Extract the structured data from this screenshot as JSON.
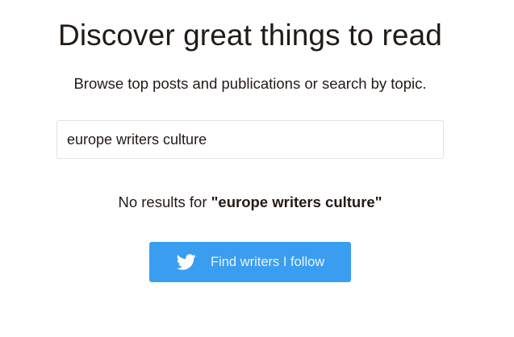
{
  "header": {
    "title": "Discover great things to read",
    "subtitle": "Browse top posts and publications or search by topic."
  },
  "search": {
    "value": "europe writers culture",
    "placeholder": ""
  },
  "results": {
    "prefix": "No results for ",
    "query": "\"europe writers culture\""
  },
  "twitter_button": {
    "label": "Find writers I follow",
    "icon": "twitter-bird-icon"
  },
  "colors": {
    "button_background": "#3a9ef0",
    "text": "#231a16",
    "border": "#e2e2e2"
  }
}
